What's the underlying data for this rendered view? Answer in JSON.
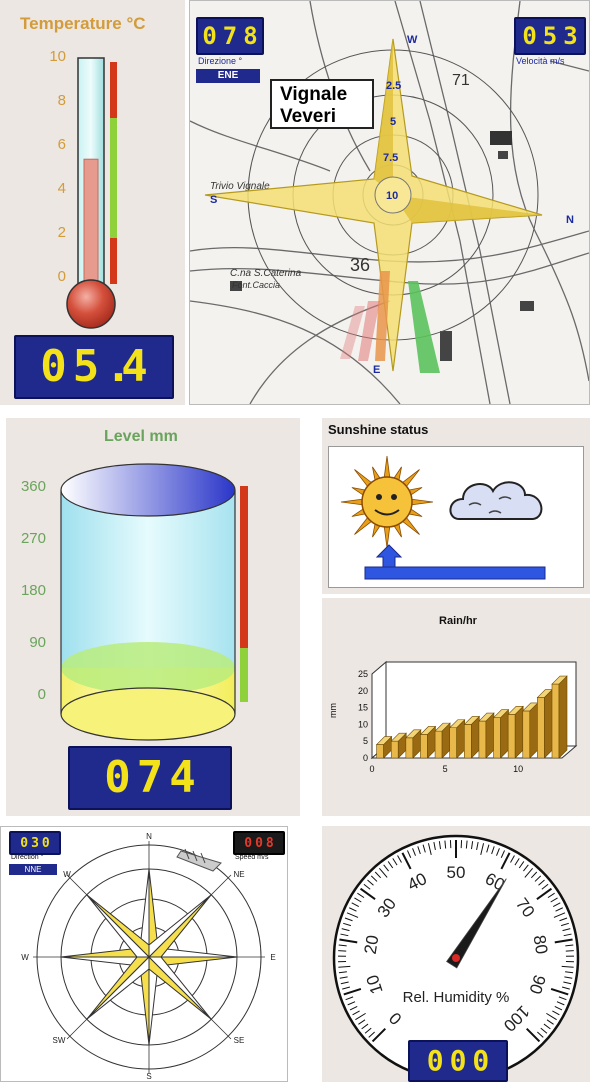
{
  "temperature": {
    "title": "Temperature °C",
    "ticks": [
      "10",
      "8",
      "6",
      "4",
      "2",
      "0"
    ],
    "value": 5.4,
    "range": [
      0,
      10
    ],
    "display": [
      "0",
      "5",
      ".",
      "4"
    ]
  },
  "wind_map": {
    "direction_display": [
      "0",
      "7",
      "8"
    ],
    "direction_label": "Direzione °",
    "direction_text": "ENE",
    "speed_display": [
      "0",
      "5",
      "3"
    ],
    "speed_label": "Velocità m/s",
    "place": [
      "Vignale",
      "Veveri"
    ],
    "rose_rings": [
      "2.5",
      "5",
      "7.5",
      "10"
    ],
    "compass": {
      "w": "W",
      "s": "S",
      "n": "N",
      "e": "E"
    },
    "map_labels": [
      "Trivio Vignale",
      "C.na S.Caterina",
      "Font.Caccia",
      "71",
      "36"
    ]
  },
  "level": {
    "title": "Level mm",
    "ticks": [
      "360",
      "270",
      "180",
      "90",
      "0"
    ],
    "value": 74,
    "range": [
      0,
      360
    ],
    "display": [
      "0",
      "7",
      "4"
    ]
  },
  "sunshine": {
    "title": "Sunshine status"
  },
  "rain": {
    "title": "Rain/hr",
    "ylabel": "mm",
    "y_ticks": [
      "25",
      "20",
      "15",
      "10",
      "5",
      "0"
    ],
    "x_ticks": [
      "0",
      "5",
      "10"
    ]
  },
  "chart_data": {
    "type": "bar",
    "title": "Rain/hr",
    "ylabel": "mm",
    "xlabel": "",
    "x": [
      1,
      2,
      3,
      4,
      5,
      6,
      7,
      8,
      9,
      10,
      11,
      12,
      13
    ],
    "values": [
      4,
      5,
      6,
      7,
      8,
      9,
      10,
      11,
      12,
      13,
      14,
      18,
      22
    ],
    "ylim": [
      0,
      25
    ],
    "xlim": [
      0,
      13
    ]
  },
  "wind_small": {
    "direction_display": [
      "0",
      "3",
      "0"
    ],
    "direction_label": "Direction °",
    "direction_text": "NNE",
    "speed_display": [
      "0",
      "0",
      "8"
    ],
    "speed_label": "Speed m/s",
    "compass": {
      "n": "N",
      "ne": "NE",
      "e": "E",
      "se": "SE",
      "s": "S",
      "sw": "SW",
      "w": "W",
      "nw": "W"
    }
  },
  "humidity": {
    "label": "Rel. Humidity %",
    "ticks": [
      "0",
      "10",
      "20",
      "30",
      "40",
      "50",
      "60",
      "70",
      "80",
      "90",
      "100"
    ],
    "value": 62,
    "display": [
      "0",
      "0",
      "0"
    ]
  },
  "colors": {
    "lcd_bg": "#1f2a8c",
    "lcd_digit": "#f3e21a",
    "temp_title": "#d39b3a",
    "level_title": "#6aa45c"
  }
}
